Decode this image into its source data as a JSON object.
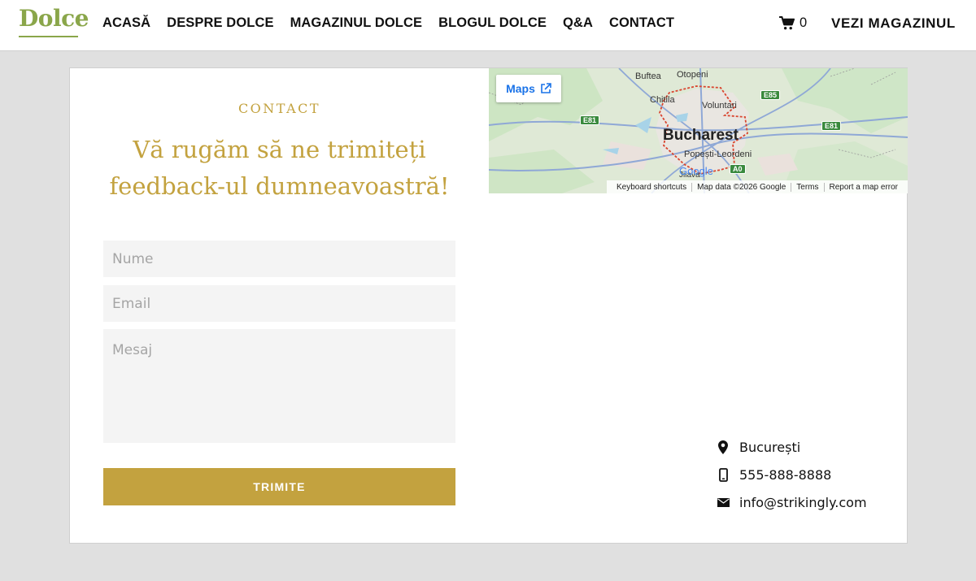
{
  "header": {
    "logo": "Dolce",
    "nav": [
      "ACASĂ",
      "DESPRE DOLCE",
      "MAGAZINUL DOLCE",
      "BLOGUL DOLCE",
      "Q&A",
      "CONTACT"
    ],
    "cart_count": "0",
    "shop_link": "VEZI MAGAZINUL"
  },
  "contact": {
    "eyebrow": "CONTACT",
    "headline": "Vă rugăm să ne trimiteți feedback-ul dumneavoastră!",
    "form": {
      "name_placeholder": "Nume",
      "email_placeholder": "Email",
      "message_placeholder": "Mesaj",
      "submit_label": "TRIMITE"
    },
    "info": {
      "location": "București",
      "phone": "555-888-8888",
      "email": "info@strikingly.com"
    }
  },
  "map": {
    "maps_button": "Maps",
    "labels": {
      "buftea": "Buftea",
      "otopeni": "Otopeni",
      "chitila": "Chitila",
      "voluntari": "Voluntari",
      "bucharest": "Bucharest",
      "popesti": "Popești-Leordeni",
      "jilava": "Jilava",
      "google": "Google"
    },
    "road_signs": {
      "e85": "E85",
      "e81_left": "E81",
      "e81_right": "E81",
      "a0": "A0"
    },
    "footer": [
      "Keyboard shortcuts",
      "Map data ©2026 Google",
      "Terms",
      "Report a map error"
    ]
  },
  "colors": {
    "brand_green": "#8aa64a",
    "accent_gold": "#c3a23f",
    "page_bg": "#e0e0e0"
  }
}
